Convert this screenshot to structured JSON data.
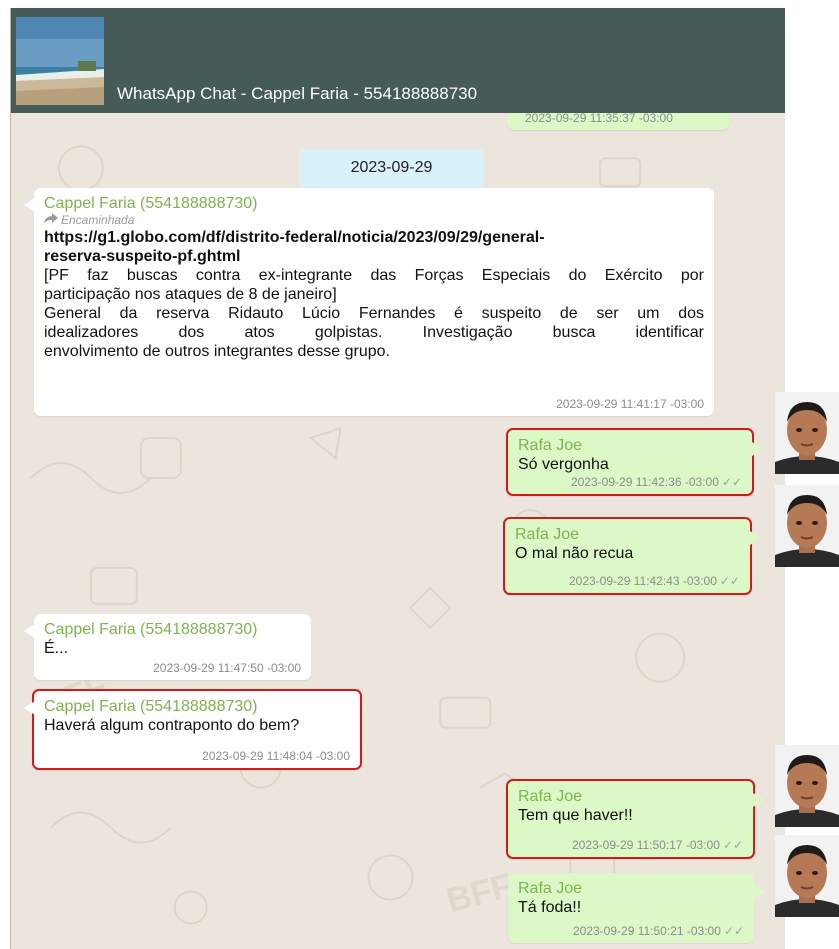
{
  "header": {
    "title": "WhatsApp Chat - Cappel Faria - 554188888730"
  },
  "top_partial_timestamp": "2023-09-29 11:35:37 -03:00",
  "date_separator": "2023-09-29",
  "forwarded_message": {
    "sender": "Cappel Faria (554188888730)",
    "forwarded_label": "Encaminhada",
    "link_line1": "https://g1.globo.com/df/distrito-federal/noticia/2023/09/29/general-",
    "link_line2": "reserva-suspeito-pf.ghtml",
    "preview_title_line1": "[PF faz buscas contra ex-integrante das Forças Especiais do Exército por",
    "preview_title_line2": "participação nos ataques de 8 de janeiro]",
    "preview_body_line1": "General da reserva Ridauto Lúcio Fernandes é suspeito de ser um dos",
    "preview_body_line2": "idealizadores dos atos golpistas. Investigação busca identificar",
    "preview_body_line3": "envolvimento de outros integrantes desse grupo.",
    "timestamp": "2023-09-29 11:41:17 -03:00"
  },
  "messages": [
    {
      "sender": "Rafa Joe",
      "text": "Só vergonha",
      "timestamp": "2023-09-29 11:42:36 -03:00",
      "ticks": "✓✓"
    },
    {
      "sender": "Rafa Joe",
      "text": "O mal não recua",
      "timestamp": "2023-09-29 11:42:43 -03:00",
      "ticks": "✓✓"
    },
    {
      "sender": "Cappel Faria (554188888730)",
      "text": "É...",
      "timestamp": "2023-09-29 11:47:50 -03:00"
    },
    {
      "sender": "Cappel Faria (554188888730)",
      "text": "Haverá algum contraponto do bem?",
      "timestamp": "2023-09-29 11:48:04 -03:00"
    },
    {
      "sender": "Rafa Joe",
      "text": "Tem que haver!!",
      "timestamp": "2023-09-29 11:50:17 -03:00",
      "ticks": "✓✓"
    },
    {
      "sender": "Rafa Joe",
      "text": "Tá foda!!",
      "timestamp": "2023-09-29 11:50:21 -03:00",
      "ticks": "✓✓"
    }
  ],
  "colors": {
    "header_bg": "#445b57",
    "chat_bg": "#ece5dd",
    "incoming_bubble": "#ffffff",
    "outgoing_bubble": "#dcf8c6",
    "sender_name": "#7fb34f",
    "highlight_border": "#d21a1a",
    "date_chip": "#d8f1fb"
  }
}
